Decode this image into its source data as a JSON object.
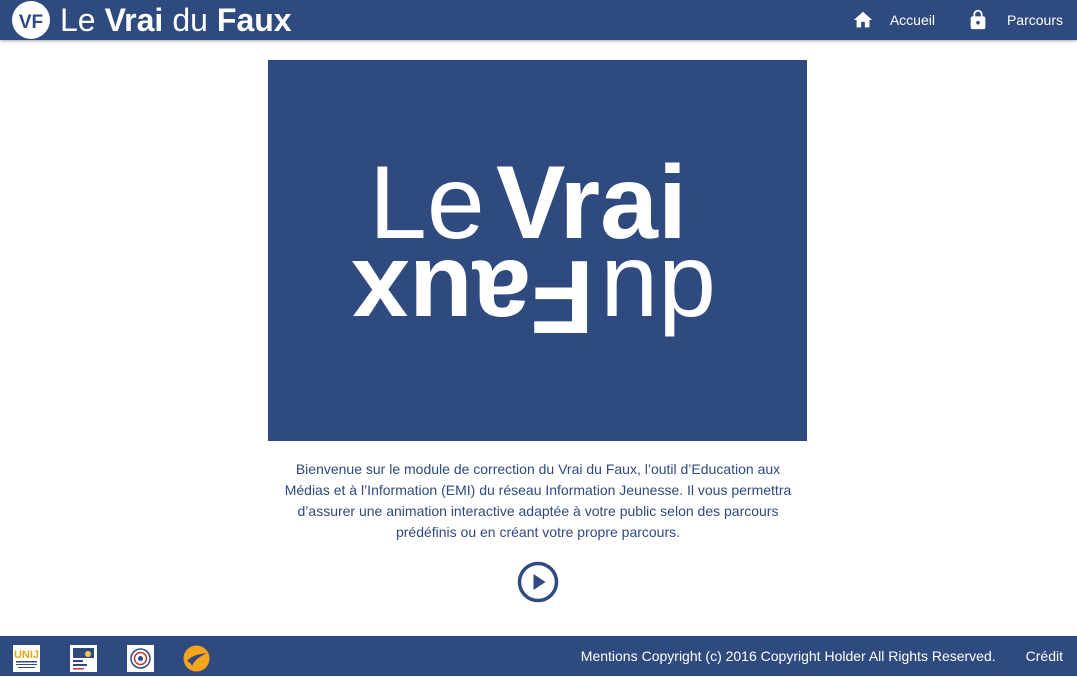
{
  "header": {
    "brand": {
      "badge_text": "VF",
      "words": [
        "Le",
        "Vrai",
        "du",
        "Faux"
      ]
    },
    "nav": [
      {
        "label": "Accueil",
        "icon": "home-icon"
      },
      {
        "label": "Parcours",
        "icon": "lock-icon"
      }
    ]
  },
  "hero": {
    "line1_light": "Le",
    "line1_bold": "Vrai",
    "line2_light": "du",
    "line2_bold": "Faux"
  },
  "intro": {
    "text": "Bienvenue sur le module de correction du Vrai du Faux, l’outil d’Education aux Médias et à l’Information (EMI) du réseau Information Jeunesse. Il vous permettra d’assurer une animation interactive adaptée à votre public selon des parcours prédéfinis ou en créant votre propre parcours."
  },
  "footer": {
    "partners": [
      {
        "name": "UNIJ",
        "icon": "uniij-logo"
      },
      {
        "name": "CIDJ",
        "icon": "cidj-logo"
      },
      {
        "name": "partner-3",
        "icon": "partner-logo"
      },
      {
        "name": "partner-4",
        "icon": "swoosh-logo"
      }
    ],
    "mentions_label": "Mentions",
    "copyright": "Copyright (c) 2016 Copyright Holder All Rights Reserved.",
    "credit_label": "Crédit"
  },
  "colors": {
    "primary": "#2f4a7f",
    "accent": "#f7a51c",
    "background": "#ffffff"
  }
}
